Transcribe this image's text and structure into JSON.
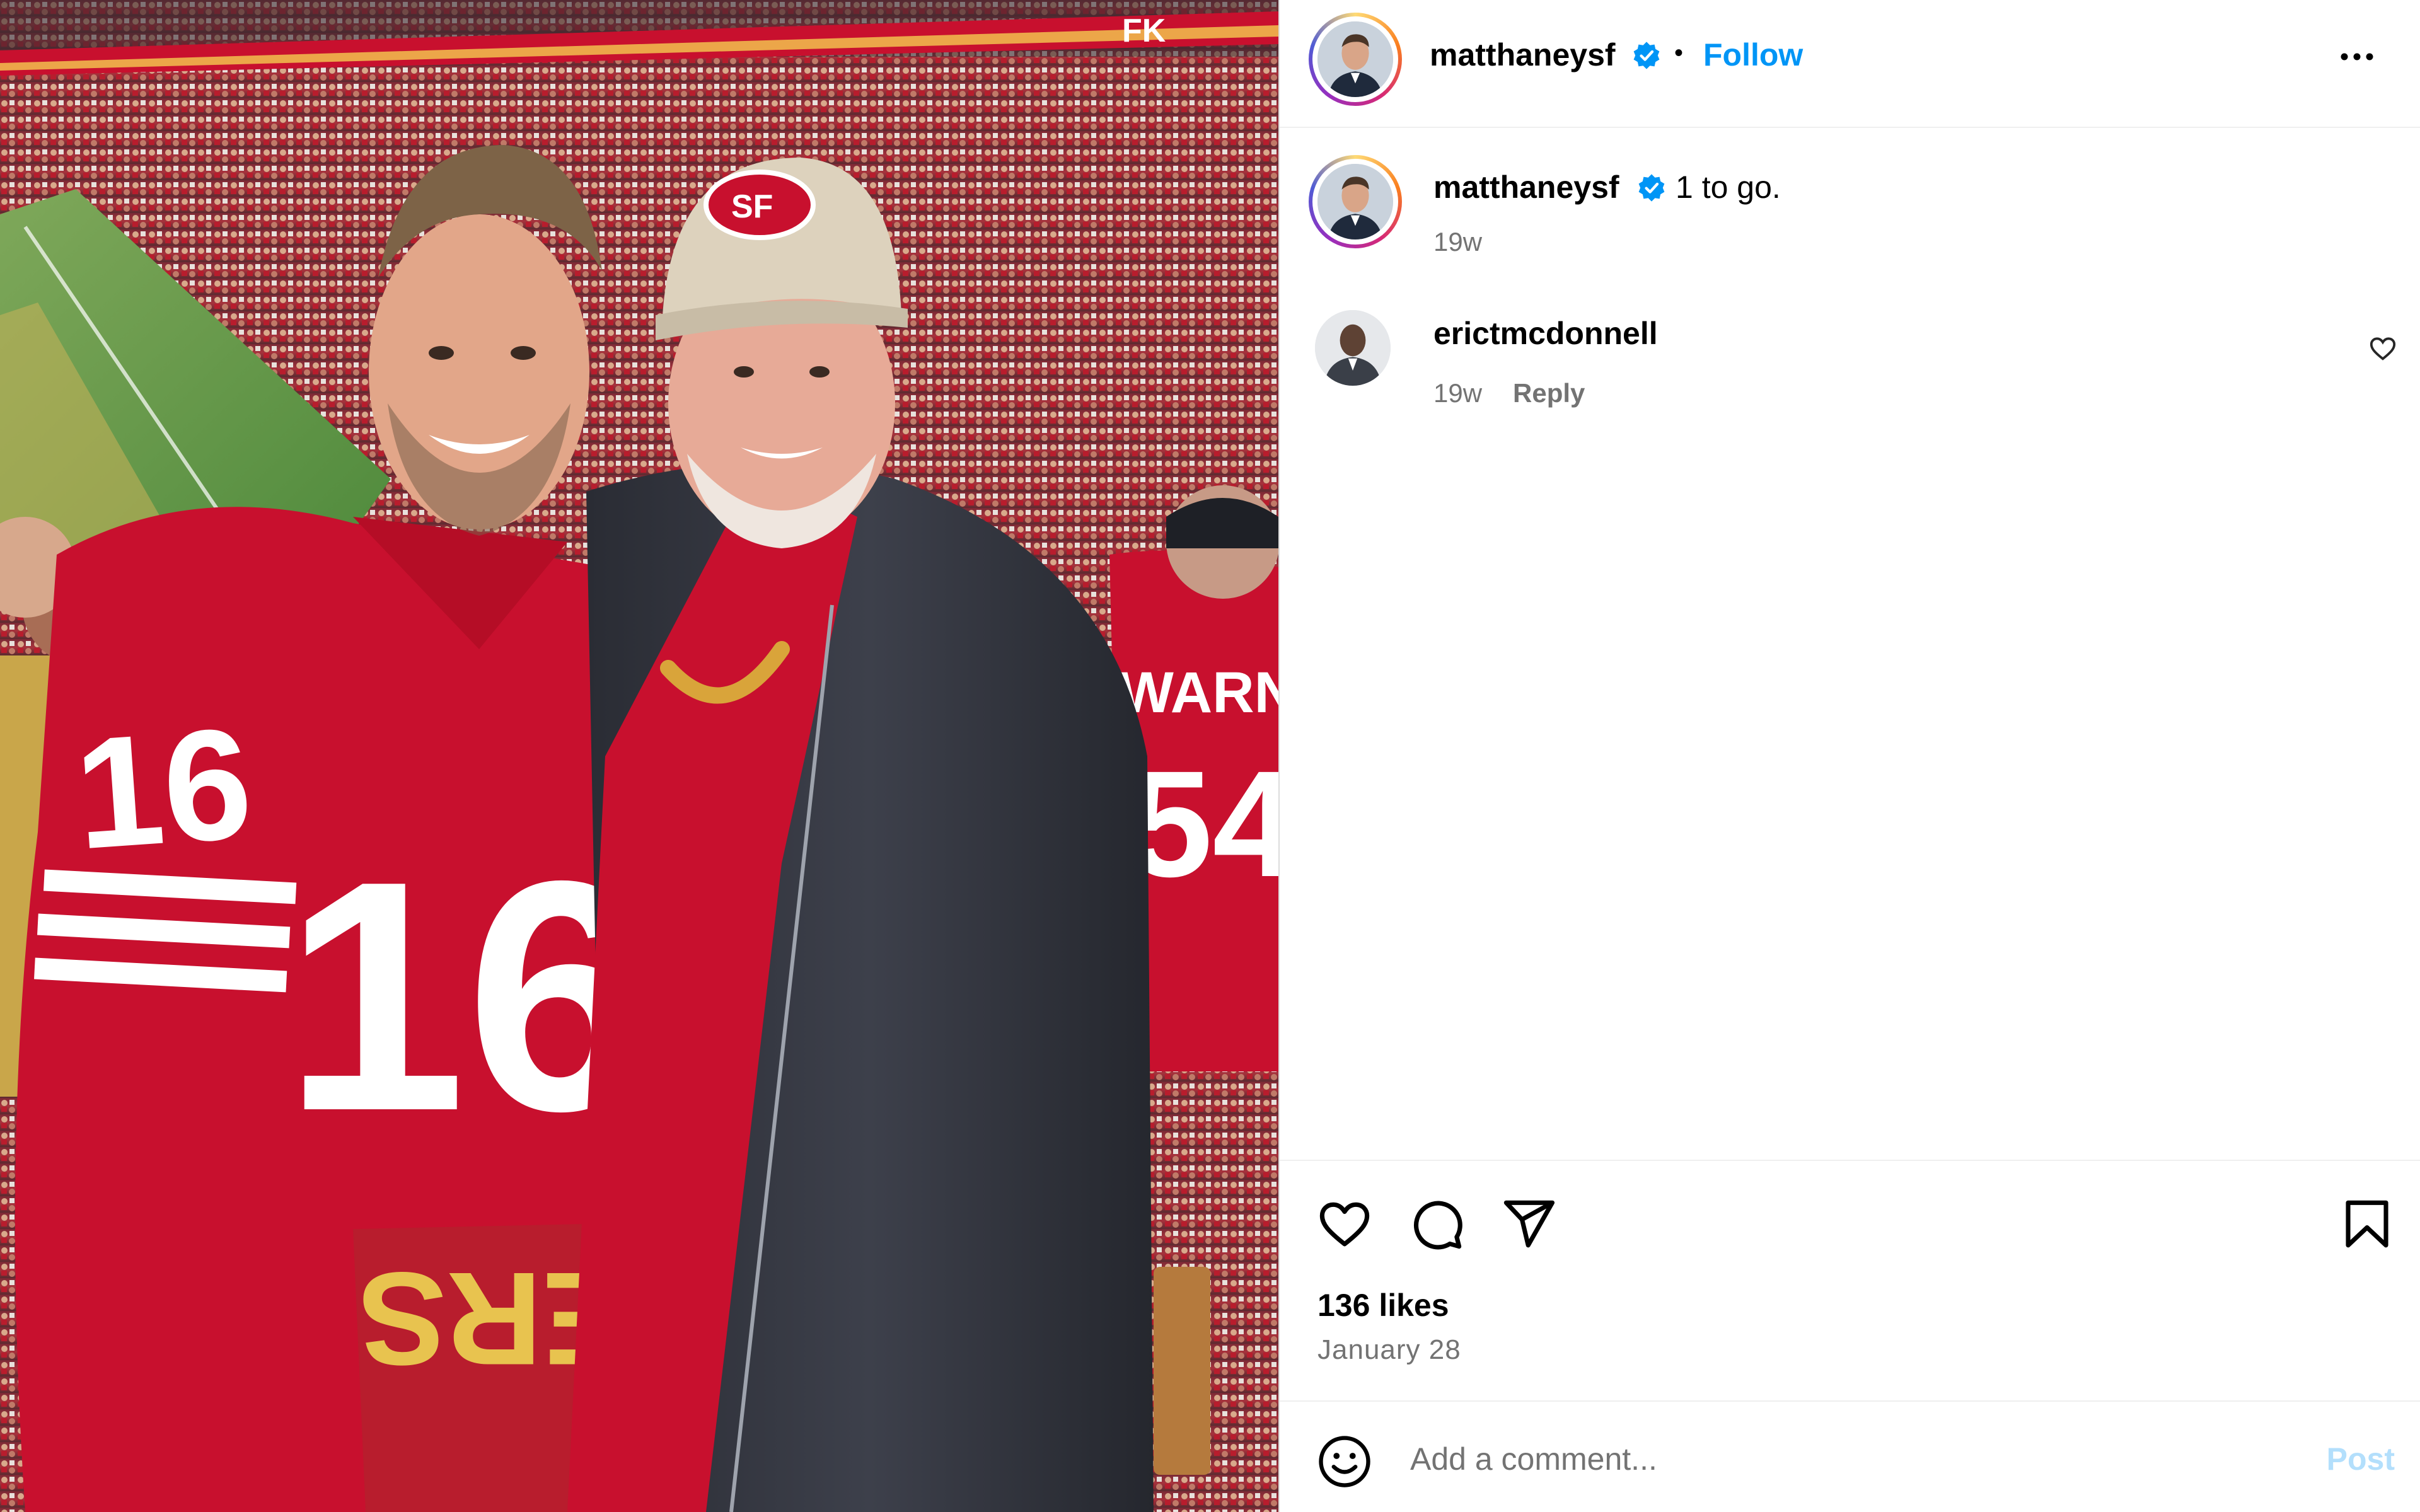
{
  "post": {
    "author": "matthaneysf",
    "verified": true,
    "follow_label": "Follow",
    "separator": "•",
    "more_icon": "more-horizontal-icon"
  },
  "caption": {
    "author": "matthaneysf",
    "text": "1 to go.",
    "age": "19w"
  },
  "comments": [
    {
      "author": "erictmcdonnell",
      "text": "",
      "age": "19w",
      "reply_label": "Reply",
      "like_icon": "heart-outline-icon"
    }
  ],
  "actions": {
    "like_icon": "heart-icon",
    "comment_icon": "comment-icon",
    "share_icon": "send-icon",
    "save_icon": "bookmark-icon"
  },
  "likes_label": "136 likes",
  "date_label": "January 28",
  "comment_box": {
    "placeholder": "Add a comment...",
    "post_label": "Post",
    "emoji_icon": "emoji-smile-icon"
  },
  "photo": {
    "jersey_number_left": "16",
    "jersey_sleeve_number": "16",
    "back_name": "WARNER",
    "back_number": "54",
    "cap_logo": "SF",
    "banner_text": "FK",
    "bag_text": "ERS"
  },
  "colors": {
    "link_blue": "#0095f6",
    "verified_blue": "#0095f6",
    "secondary_text": "#737373",
    "post_disabled": "#b3dffc",
    "niners_red": "#c8102e",
    "divider": "#dbdbdb"
  }
}
